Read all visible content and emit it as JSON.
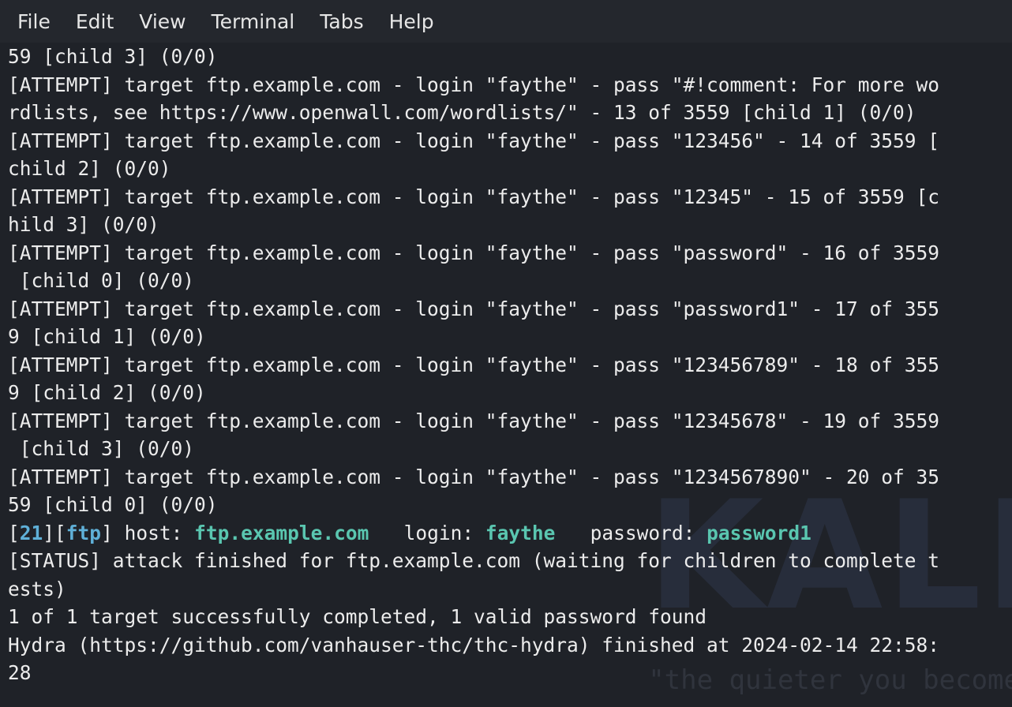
{
  "menu": [
    "File",
    "Edit",
    "View",
    "Terminal",
    "Tabs",
    "Help"
  ],
  "watermark": {
    "logo": "KALI",
    "tagline": "\"the quieter you become"
  },
  "colors": {
    "background": "#1f2228",
    "text": "#ececec",
    "port": "#5fb0d8",
    "credential": "#5ac6b0"
  },
  "terminal": {
    "lines": [
      "59 [child 3] (0/0)",
      "[ATTEMPT] target ftp.example.com - login \"faythe\" - pass \"#!comment: For more wo",
      "rdlists, see https://www.openwall.com/wordlists/\" - 13 of 3559 [child 1] (0/0)",
      "[ATTEMPT] target ftp.example.com - login \"faythe\" - pass \"123456\" - 14 of 3559 [",
      "child 2] (0/0)",
      "[ATTEMPT] target ftp.example.com - login \"faythe\" - pass \"12345\" - 15 of 3559 [c",
      "hild 3] (0/0)",
      "[ATTEMPT] target ftp.example.com - login \"faythe\" - pass \"password\" - 16 of 3559",
      " [child 0] (0/0)",
      "[ATTEMPT] target ftp.example.com - login \"faythe\" - pass \"password1\" - 17 of 355",
      "9 [child 1] (0/0)",
      "[ATTEMPT] target ftp.example.com - login \"faythe\" - pass \"123456789\" - 18 of 355",
      "9 [child 2] (0/0)",
      "[ATTEMPT] target ftp.example.com - login \"faythe\" - pass \"12345678\" - 19 of 3559",
      " [child 3] (0/0)",
      "[ATTEMPT] target ftp.example.com - login \"faythe\" - pass \"1234567890\" - 20 of 35",
      "59 [child 0] (0/0)"
    ],
    "result": {
      "bracket_open": "[",
      "port": "21",
      "bracket_mid": "][",
      "service": "ftp",
      "bracket_close": "] host: ",
      "host": "ftp.example.com",
      "login_label": "   login: ",
      "login": "faythe",
      "password_label": "   password: ",
      "password": "password1"
    },
    "after": [
      "[STATUS] attack finished for ftp.example.com (waiting for children to complete t",
      "ests)",
      "1 of 1 target successfully completed, 1 valid password found",
      "Hydra (https://github.com/vanhauser-thc/thc-hydra) finished at 2024-02-14 22:58:",
      "28"
    ]
  }
}
